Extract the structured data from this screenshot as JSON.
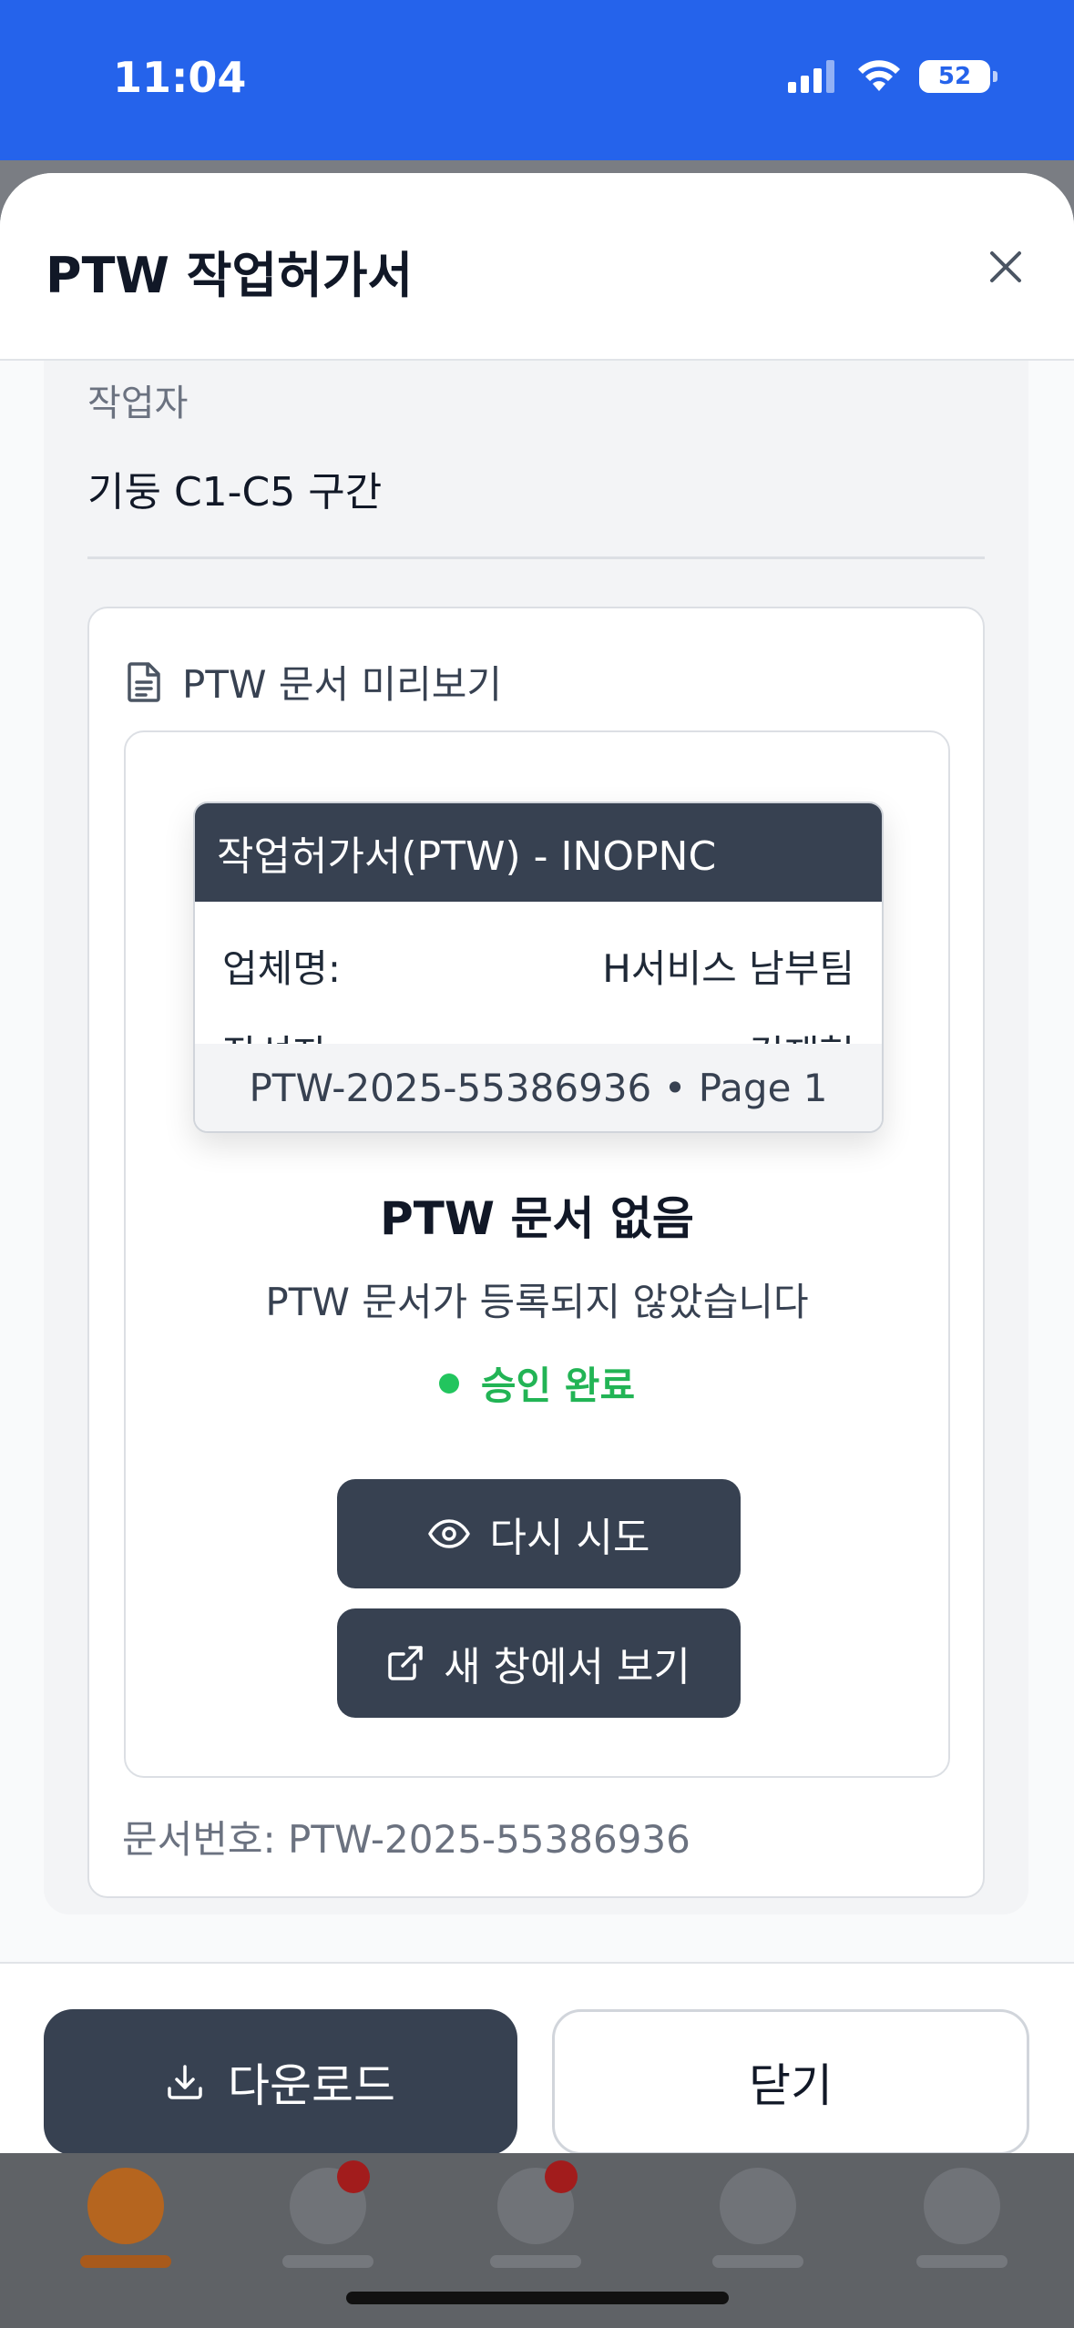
{
  "status_bar": {
    "time": "11:04",
    "battery": "52",
    "colors": {
      "bar": "#2563eb"
    }
  },
  "modal": {
    "title": "PTW 작업허가서",
    "field": {
      "label": "작업자",
      "value": "기둥 C1-C5 구간"
    },
    "preview": {
      "heading": "PTW 문서 미리보기",
      "document": {
        "header": "작업허가서(PTW) - INOPNC",
        "rows": [
          {
            "label": "업체명:",
            "value": "H서비스 남부팀"
          },
          {
            "label": "작성자:",
            "value": "김재형"
          }
        ],
        "footer": "PTW-2025-55386936 • Page 1"
      },
      "empty_title": "PTW 문서 없음",
      "empty_subtitle": "PTW 문서가 등록되지 않았습니다",
      "status": "승인 완료",
      "retry_button": "다시 시도",
      "open_button": "새 창에서 보기",
      "doc_number": "문서번호: PTW-2025-55386936"
    },
    "footer": {
      "download_button": "다운로드",
      "close_button": "닫기"
    }
  },
  "icons": [
    "signal-icon",
    "wifi-icon",
    "battery-icon",
    "close-icon",
    "document-icon",
    "eye-icon",
    "external-link-icon",
    "download-icon"
  ],
  "colors": {
    "primary_dark": "#374151",
    "status_green": "#22c55e",
    "accent_blue": "#2563eb"
  }
}
